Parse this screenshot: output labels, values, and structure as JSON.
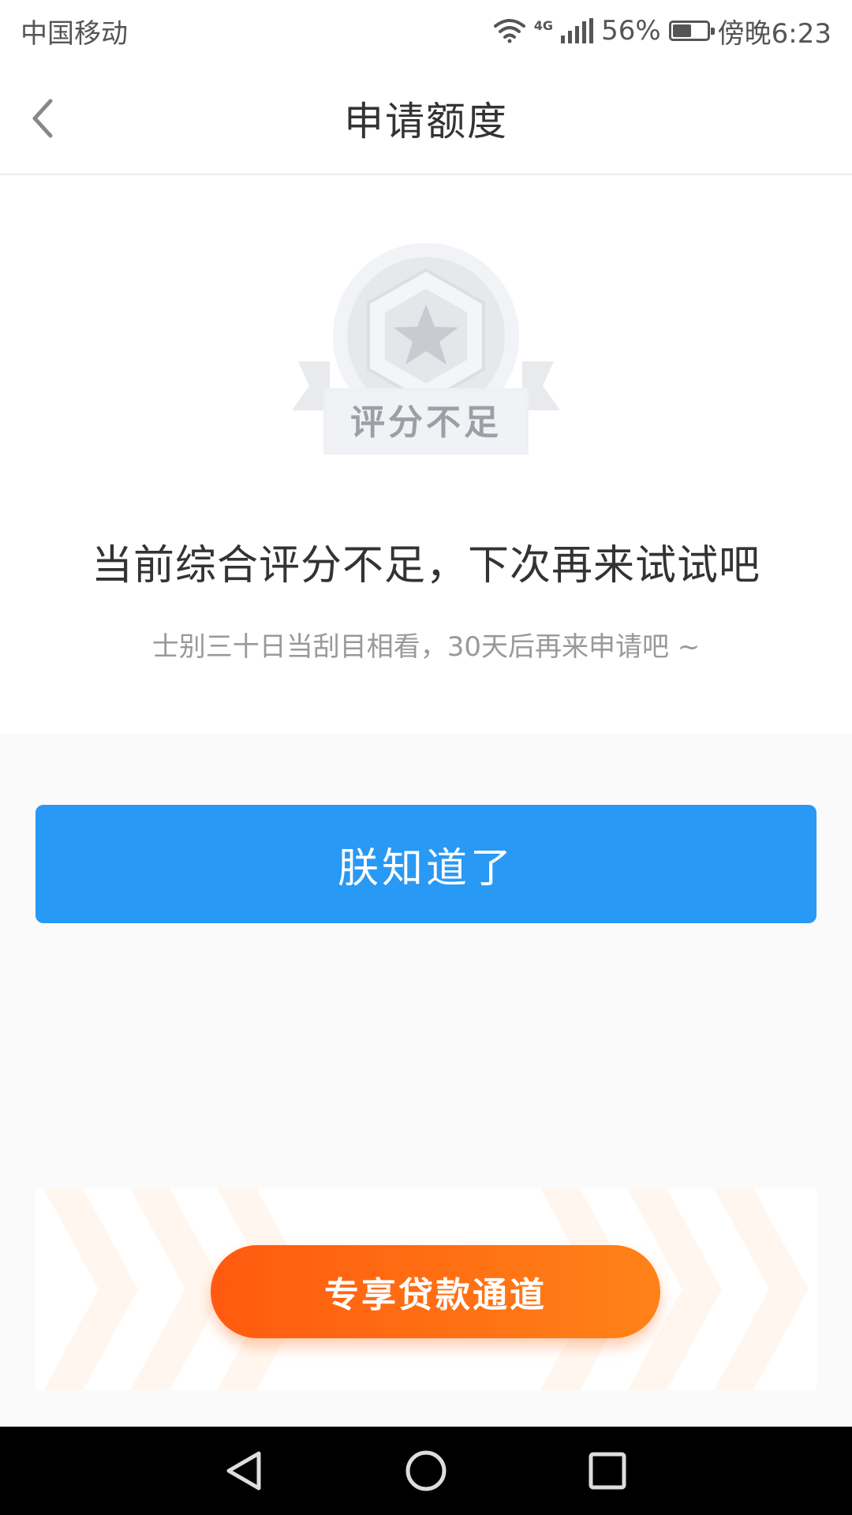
{
  "status_bar": {
    "carrier": "中国移动",
    "network_type": "4G",
    "battery_percent": "56%",
    "battery_level": 0.56,
    "time": "傍晚6:23"
  },
  "nav": {
    "title": "申请额度",
    "back_icon": "chevron-left-icon"
  },
  "result": {
    "badge_label": "评分不足",
    "badge_icon": "star-medal-icon",
    "headline": "当前综合评分不足，下次再来试试吧",
    "subline": "士别三十日当刮目相看，30天后再来申请吧 ~"
  },
  "actions": {
    "primary_label": "朕知道了",
    "promo_label": "专享贷款通道"
  },
  "system_nav": {
    "back_icon": "triangle-back-icon",
    "home_icon": "circle-home-icon",
    "recents_icon": "square-recents-icon"
  },
  "colors": {
    "primary_blue": "#2899f5",
    "promo_orange": "#ff6a12",
    "text_dark": "#333333",
    "text_gray": "#999999"
  }
}
